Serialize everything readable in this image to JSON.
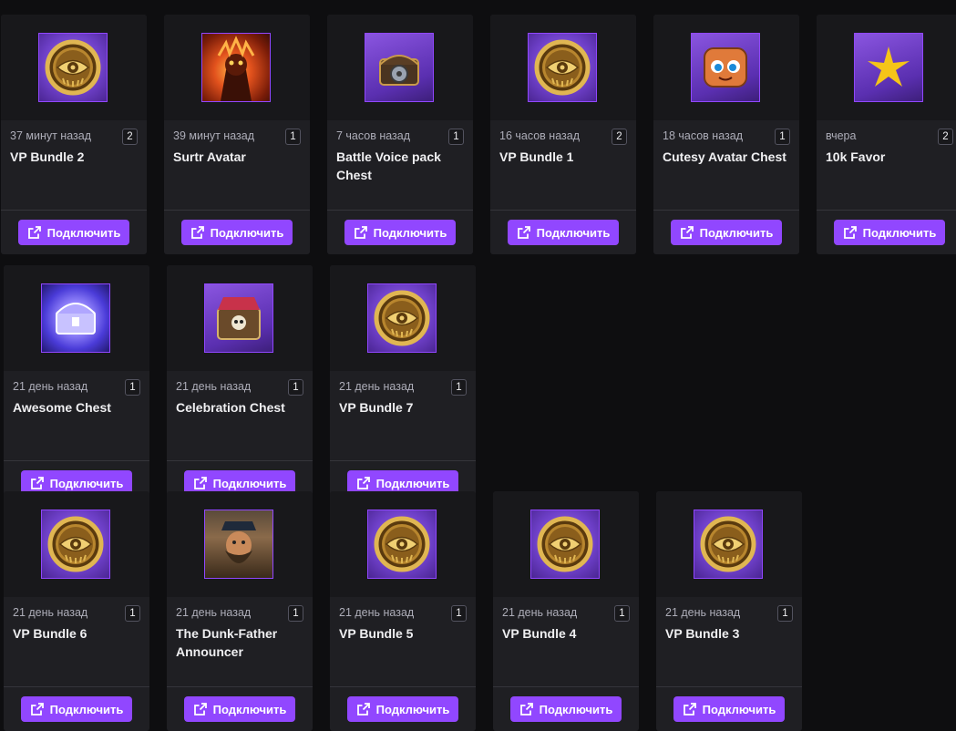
{
  "button_label": "Подключить",
  "accent_color": "#9147ff",
  "rewards": [
    {
      "time": "37 минут назад",
      "count": "2",
      "title": "VP Bundle 2",
      "icon": "eye-coin-icon"
    },
    {
      "time": "39 минут назад",
      "count": "1",
      "title": "Surtr Avatar",
      "icon": "fire-giant-avatar-icon"
    },
    {
      "time": "7 часов назад",
      "count": "1",
      "title": "Battle Voice pack Chest",
      "icon": "voice-pack-chest-icon"
    },
    {
      "time": "16 часов назад",
      "count": "2",
      "title": "VP Bundle 1",
      "icon": "eye-coin-icon"
    },
    {
      "time": "18 часов назад",
      "count": "1",
      "title": "Cutesy Avatar Chest",
      "icon": "cute-chest-icon"
    },
    {
      "time": "вчера",
      "count": "2",
      "title": "10k Favor",
      "icon": "favor-star-icon"
    },
    {
      "time": "21 день назад",
      "count": "1",
      "title": "Awesome Chest",
      "icon": "awesome-chest-icon"
    },
    {
      "time": "21 день назад",
      "count": "1",
      "title": "Celebration Chest",
      "icon": "celebration-chest-icon"
    },
    {
      "time": "21 день назад",
      "count": "1",
      "title": "VP Bundle 7",
      "icon": "eye-coin-icon"
    },
    {
      "time": "21 день назад",
      "count": "1",
      "title": "VP Bundle 6",
      "icon": "eye-coin-icon"
    },
    {
      "time": "21 день назад",
      "count": "1",
      "title": "The Dunk-Father Announcer",
      "icon": "dunk-father-icon"
    },
    {
      "time": "21 день назад",
      "count": "1",
      "title": "VP Bundle 5",
      "icon": "eye-coin-icon"
    },
    {
      "time": "21 день назад",
      "count": "1",
      "title": "VP Bundle 4",
      "icon": "eye-coin-icon"
    },
    {
      "time": "21 день назад",
      "count": "1",
      "title": "VP Bundle 3",
      "icon": "eye-coin-icon"
    }
  ]
}
